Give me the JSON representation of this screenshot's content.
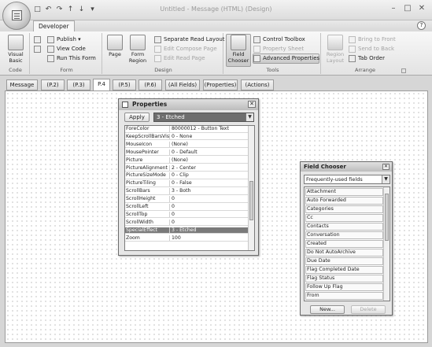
{
  "window": {
    "title": "Untitled - Message (HTML)  (Design)",
    "qat_icons": [
      "save-icon",
      "undo-icon",
      "redo-icon",
      "up-arrow-icon",
      "down-arrow-icon",
      "customize-icon"
    ],
    "controls": [
      "minimize-icon",
      "restore-icon",
      "close-icon"
    ]
  },
  "ribbon": {
    "tab_developer": "Developer",
    "groups": {
      "code": {
        "label": "Code",
        "visual_basic_line1": "Visual",
        "visual_basic_line2": "Basic"
      },
      "form": {
        "label": "Form",
        "publish": "Publish",
        "view_code": "View Code",
        "run_this_form": "Run This Form"
      },
      "design": {
        "label": "Design",
        "page_line1": "Page",
        "form_region_line1": "Form",
        "form_region_line2": "Region",
        "separate_read_layout": "Separate Read Layout",
        "edit_compose_page": "Edit Compose Page",
        "edit_read_page": "Edit Read Page"
      },
      "tools": {
        "label": "Tools",
        "field_chooser_line1": "Field",
        "field_chooser_line2": "Chooser",
        "control_toolbox": "Control Toolbox",
        "property_sheet": "Property Sheet",
        "advanced_properties": "Advanced Properties"
      },
      "arrange": {
        "label": "Arrange",
        "region_layout_line1": "Region",
        "region_layout_line2": "Layout",
        "bring_to_front": "Bring to Front",
        "send_to_back": "Send to Back",
        "tab_order": "Tab Order"
      }
    }
  },
  "page_tabs": [
    "Message",
    "(P.2)",
    "(P.3)",
    "P.4",
    "(P.5)",
    "(P.6)",
    "(All Fields)",
    "(Properties)",
    "(Actions)"
  ],
  "active_page_tab": "P.4",
  "properties": {
    "title": "Properties",
    "apply": "Apply",
    "combo_value": "3 - Etched",
    "rows": [
      {
        "name": "ForeColor",
        "value": "80000012 - Button Text"
      },
      {
        "name": "KeepScrollBarsVisi",
        "value": "0 - None"
      },
      {
        "name": "MouseIcon",
        "value": "(None)"
      },
      {
        "name": "MousePointer",
        "value": "0 - Default"
      },
      {
        "name": "Picture",
        "value": "(None)"
      },
      {
        "name": "PictureAlignment",
        "value": "2 - Center"
      },
      {
        "name": "PictureSizeMode",
        "value": "0 - Clip"
      },
      {
        "name": "PictureTiling",
        "value": "0 - False"
      },
      {
        "name": "ScrollBars",
        "value": "3 - Both"
      },
      {
        "name": "ScrollHeight",
        "value": "0"
      },
      {
        "name": "ScrollLeft",
        "value": "0"
      },
      {
        "name": "ScrollTop",
        "value": "0"
      },
      {
        "name": "ScrollWidth",
        "value": "0"
      },
      {
        "name": "SpecialEffect",
        "value": "3 - Etched"
      },
      {
        "name": "Zoom",
        "value": "100"
      }
    ],
    "selected_row": 13
  },
  "field_chooser": {
    "title": "Field Chooser",
    "combo_value": "Frequently-used fields",
    "fields": [
      "Attachment",
      "Auto Forwarded",
      "Categories",
      "Cc",
      "Contacts",
      "Conversation",
      "Created",
      "Do Not AutoArchive",
      "Due Date",
      "Flag Completed Date",
      "Flag Status",
      "Follow Up Flag",
      "From"
    ],
    "new_button": "New...",
    "delete_button": "Delete"
  }
}
